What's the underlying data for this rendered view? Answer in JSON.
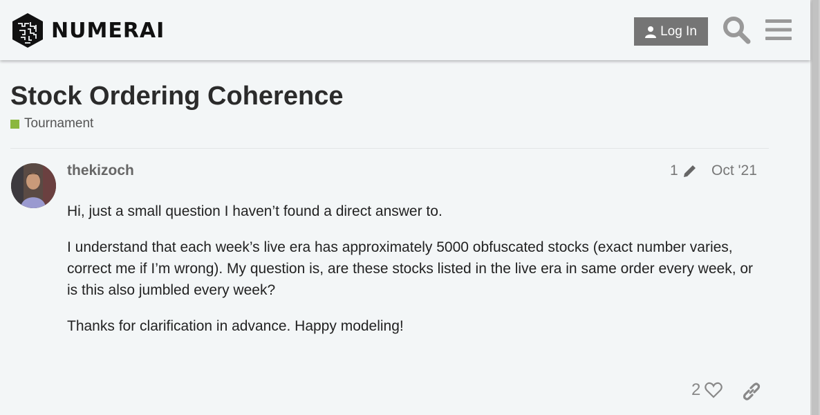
{
  "header": {
    "brand": "NUMERAI",
    "login_label": "Log In",
    "icons": {
      "user": "user-icon",
      "search": "search-icon",
      "menu": "hamburger-menu-icon"
    }
  },
  "topic": {
    "title": "Stock Ordering Coherence",
    "category": {
      "label": "Tournament",
      "color": "#8bb73f"
    }
  },
  "post": {
    "username": "thekizoch",
    "edit_count": "1",
    "date": "Oct '21",
    "paragraphs": [
      "Hi, just a small question I haven’t found a direct answer to.",
      "I understand that each week’s live era has approximately 5000 obfuscated stocks (exact number varies, correct me if I’m wrong). My question is, are these stocks listed in the live era in same order every week, or is this also jumbled every week?",
      "Thanks for clarification in advance. Happy modeling!"
    ],
    "like_count": "2"
  },
  "colors": {
    "button_bg": "#757575",
    "accent": "#8bb73f",
    "background": "#f3f6f7"
  }
}
